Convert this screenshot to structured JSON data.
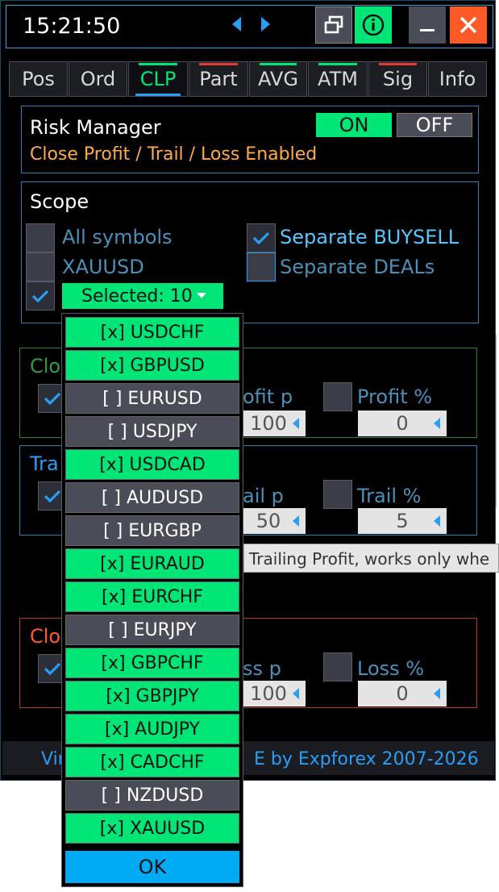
{
  "colors": {
    "accent_green": "#00e676",
    "accent_blue": "#2a9df4",
    "orange": "#ffa94d",
    "close_red": "#ff5a26"
  },
  "header": {
    "clock": "15:21:50",
    "icons": [
      "chevron-left-icon",
      "chevron-right-icon",
      "restore-window-icon",
      "info-icon",
      "minimize-icon",
      "close-icon"
    ]
  },
  "tabs": [
    {
      "label": "Pos",
      "mark": ""
    },
    {
      "label": "Ord",
      "mark": ""
    },
    {
      "label": "CLP",
      "mark": "#00e676"
    },
    {
      "label": "Part",
      "mark": "#e53935"
    },
    {
      "label": "AVG",
      "mark": "#00e676"
    },
    {
      "label": "ATM",
      "mark": "#00e676"
    },
    {
      "label": "Sig",
      "mark": "#e53935"
    },
    {
      "label": "Info",
      "mark": ""
    }
  ],
  "risk": {
    "title": "Risk Manager",
    "on_label": "ON",
    "off_label": "OFF",
    "status": "Close Profit / Trail / Loss Enabled"
  },
  "scope": {
    "title": "Scope",
    "all_symbols": "All symbols",
    "separate_buysell": "Separate BUYSELL",
    "symbol": "XAUUSD",
    "separate_deals": "Separate DEALs",
    "selected": "Selected: 10"
  },
  "close_profit": {
    "title": "Clo",
    "label_points": "ofit p",
    "value_points": "100",
    "label_percent": "Profit %",
    "value_percent": "0"
  },
  "trail": {
    "title": "Tra",
    "label_points": "ail p",
    "value_points": "50",
    "label_percent": "Trail %",
    "value_percent": "5"
  },
  "close_loss": {
    "title": "Clo",
    "label_points": "ss p",
    "value_points": "100",
    "label_percent": "Loss %",
    "value_percent": "0"
  },
  "tooltip": "Trailing Profit, works only whe",
  "footer": {
    "left": "Vir",
    "right": "E by Expforex 2007-2026"
  },
  "dropdown": {
    "items": [
      {
        "label": "[x] USDCHF",
        "checked": true
      },
      {
        "label": "[x] GBPUSD",
        "checked": true
      },
      {
        "label": "[ ] EURUSD",
        "checked": false
      },
      {
        "label": "[ ] USDJPY",
        "checked": false
      },
      {
        "label": "[x] USDCAD",
        "checked": true
      },
      {
        "label": "[ ] AUDUSD",
        "checked": false
      },
      {
        "label": "[ ] EURGBP",
        "checked": false
      },
      {
        "label": "[x] EURAUD",
        "checked": true
      },
      {
        "label": "[x] EURCHF",
        "checked": true
      },
      {
        "label": "[ ] EURJPY",
        "checked": false
      },
      {
        "label": "[x] GBPCHF",
        "checked": true
      },
      {
        "label": "[x] GBPJPY",
        "checked": true
      },
      {
        "label": "[x] AUDJPY",
        "checked": true
      },
      {
        "label": "[x] CADCHF",
        "checked": true
      },
      {
        "label": "[ ] NZDUSD",
        "checked": false
      },
      {
        "label": "[x] XAUUSD",
        "checked": true
      }
    ],
    "ok_label": "OK"
  }
}
